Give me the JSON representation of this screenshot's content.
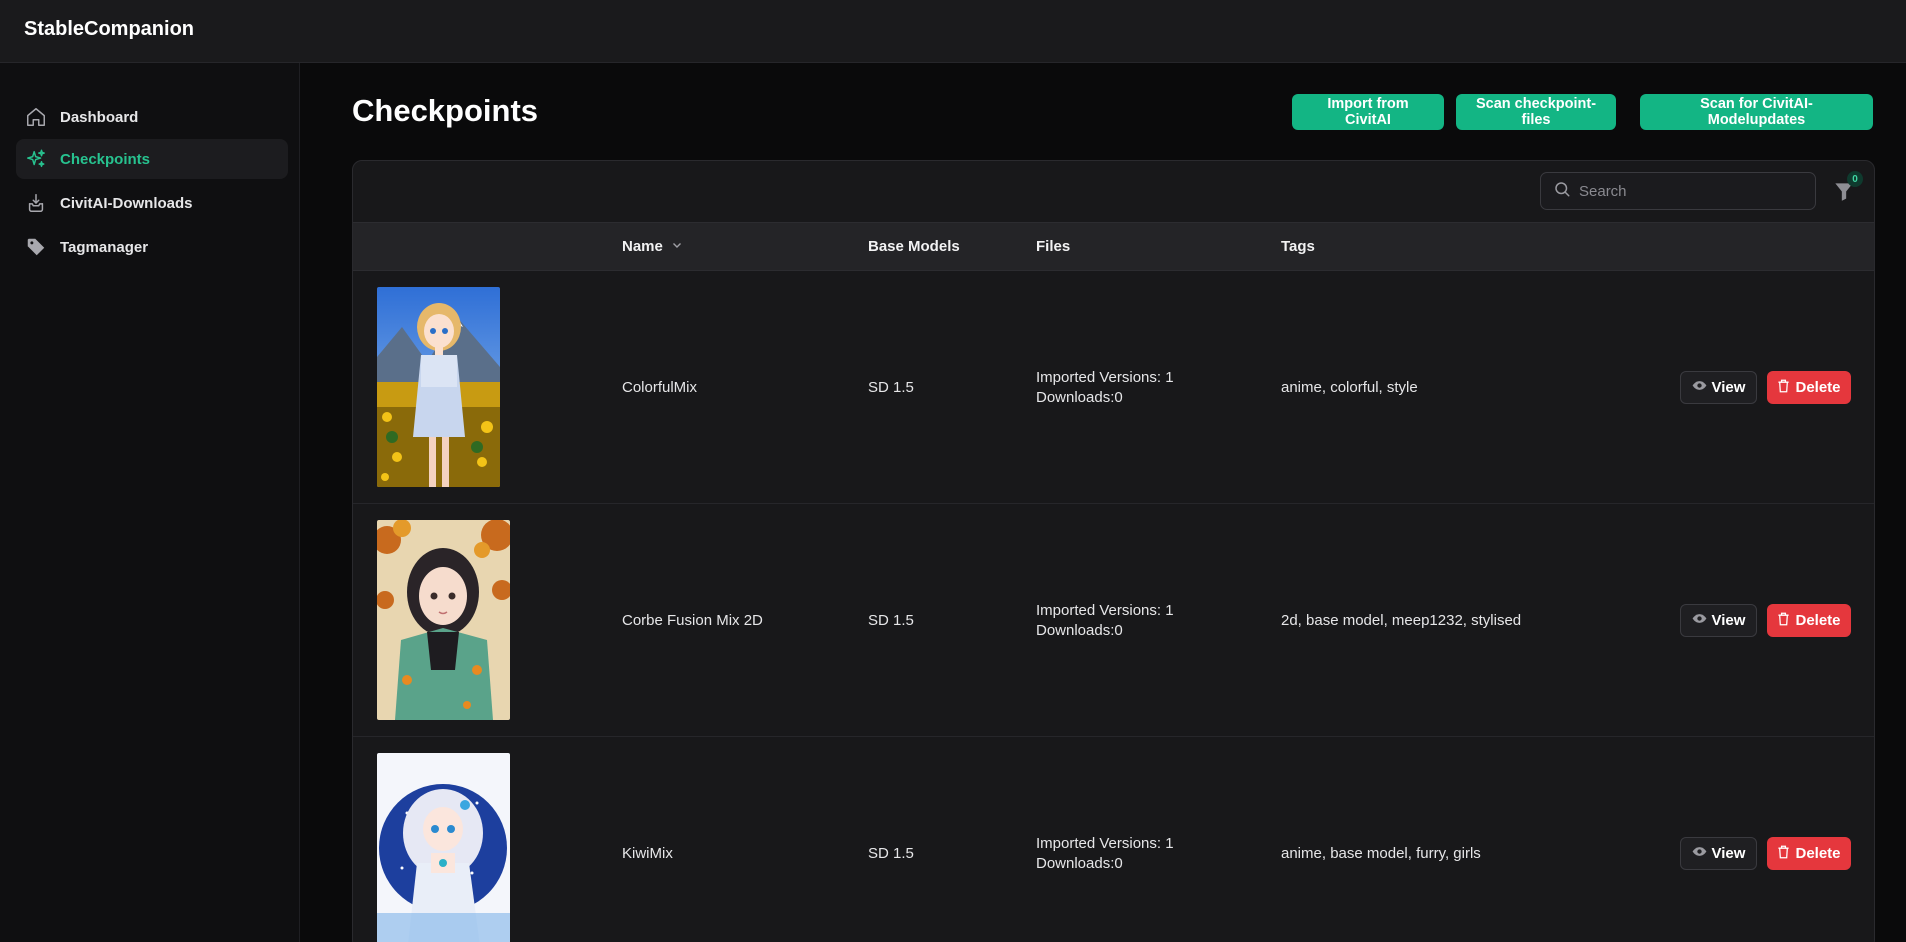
{
  "app": {
    "title": "StableCompanion"
  },
  "sidebar": {
    "items": [
      {
        "label": "Dashboard",
        "icon": "home-icon",
        "active": false
      },
      {
        "label": "Checkpoints",
        "icon": "sparkles-icon",
        "active": true
      },
      {
        "label": "CivitAI-Downloads",
        "icon": "download-icon",
        "active": false
      },
      {
        "label": "Tagmanager",
        "icon": "tag-icon",
        "active": false
      }
    ]
  },
  "page": {
    "title": "Checkpoints",
    "actions": {
      "import_label": "Import from CivitAI",
      "scan_files_label": "Scan checkpoint-files",
      "scan_updates_label": "Scan for CivitAI-Modelupdates"
    }
  },
  "toolbar": {
    "search_placeholder": "Search",
    "filter_count": "0"
  },
  "table": {
    "columns": [
      "Name",
      "Base Models",
      "Files",
      "Tags"
    ],
    "sort_column": "Name",
    "rows": [
      {
        "name": "ColorfulMix",
        "base_model": "SD 1.5",
        "files_versions": "Imported Versions: 1",
        "files_downloads": "Downloads:0",
        "tags": "anime, colorful, style",
        "view_label": "View",
        "delete_label": "Delete",
        "thumbnail": "anime-girl-sunflower-field"
      },
      {
        "name": "Corbe Fusion Mix 2D",
        "base_model": "SD 1.5",
        "files_versions": "Imported Versions: 1",
        "files_downloads": "Downloads:0",
        "tags": "2d, base model, meep1232, stylised",
        "view_label": "View",
        "delete_label": "Delete",
        "thumbnail": "girl-green-jacket-autumn"
      },
      {
        "name": "KiwiMix",
        "base_model": "SD 1.5",
        "files_versions": "Imported Versions: 1",
        "files_downloads": "Downloads:0",
        "tags": "anime, base model, furry, girls",
        "view_label": "View",
        "delete_label": "Delete",
        "thumbnail": "chibi-girl-white-hair-blue"
      }
    ]
  },
  "colors": {
    "accent": "#13b584",
    "active_nav": "#27c28f",
    "danger": "#e5373d",
    "background": "#0a0a0b",
    "card": "#18181a"
  }
}
